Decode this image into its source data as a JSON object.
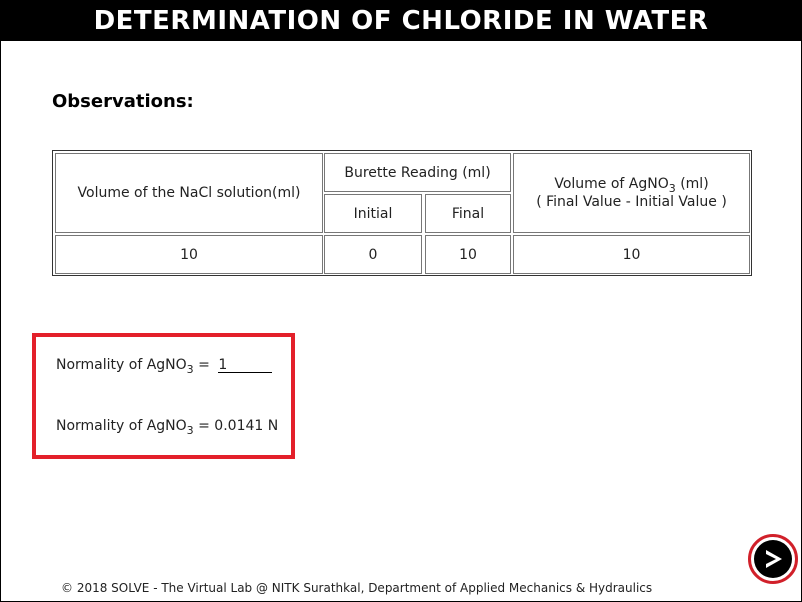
{
  "header": {
    "title": "DETERMINATION OF CHLORIDE IN WATER"
  },
  "observations": {
    "title": "Observations:"
  },
  "table": {
    "col_nacl": "Volume of the NaCl solution(ml)",
    "col_burette": "Burette Reading (ml)",
    "col_initial": "Initial",
    "col_final": "Final",
    "col_agno3_line1_pre": "Volume of AgNO",
    "col_agno3_sub": "3",
    "col_agno3_line1_post": " (ml)",
    "col_agno3_line2": "( Final Value - Initial Value )",
    "row": {
      "nacl": "10",
      "initial": "0",
      "final": "10",
      "agno3": "10"
    }
  },
  "calc": {
    "label_pre": "Normality of AgNO",
    "label_sub": "3",
    "label_post": " =",
    "input_value": "1",
    "result_pre": "Normality of AgNO",
    "result_sub": "3",
    "result_post": " = 0.0141 N"
  },
  "footer": {
    "text": "© 2018 SOLVE - The Virtual Lab @ NITK Surathkal, Department of Applied Mechanics & Hydraulics"
  },
  "colors": {
    "header_bg": "#000000",
    "highlight_border": "#e3202a"
  },
  "icons": {
    "next": "next-arrow-icon"
  }
}
